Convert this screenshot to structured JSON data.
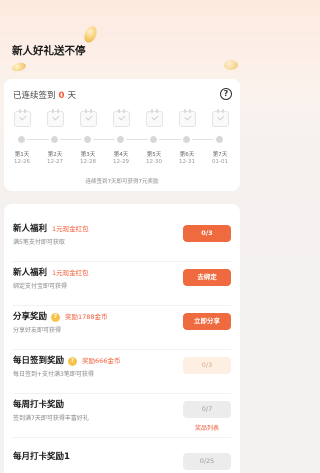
{
  "page_title": "新人好礼送不停",
  "signin": {
    "streak_prefix": "已连续签到",
    "streak_count": "0",
    "streak_unit": "天",
    "help_icon": "?",
    "days": [
      {
        "label": "第1天",
        "date": "12-26"
      },
      {
        "label": "第2天",
        "date": "12-27"
      },
      {
        "label": "第3天",
        "date": "12-28"
      },
      {
        "label": "第4天",
        "date": "12-29"
      },
      {
        "label": "第5天",
        "date": "12-30"
      },
      {
        "label": "第6天",
        "date": "12-31"
      },
      {
        "label": "第7天",
        "date": "01-01"
      }
    ],
    "note": "连续签到7天即可获得7元奖励"
  },
  "tasks": [
    {
      "title": "新人福利",
      "reward": "1元现金红包",
      "desc": "满5笔支付即可获取",
      "button": "0/3",
      "style": "orange"
    },
    {
      "title": "新人福利",
      "reward": "1元现金红包",
      "desc": "绑定支付宝即可获得",
      "button": "去绑定",
      "style": "orange"
    },
    {
      "title": "分享奖励",
      "badge": "?",
      "reward": "奖励1788金币",
      "desc": "分享好友即可获得",
      "button": "立即分享",
      "style": "orange"
    },
    {
      "title": "每日签到奖励",
      "badge": "?",
      "reward": "奖励666金币",
      "desc": "每日签到+支付满3笔即可获得",
      "button": "0/3",
      "style": "light"
    },
    {
      "title": "每周打卡奖励",
      "reward": "",
      "desc": "签到满7天即可获得丰富好礼",
      "button": "0/7",
      "style": "gray",
      "sublink": "奖品列表"
    },
    {
      "title": "每月打卡奖励1",
      "reward": "",
      "desc": "",
      "button": "0/25",
      "style": "gray"
    }
  ]
}
